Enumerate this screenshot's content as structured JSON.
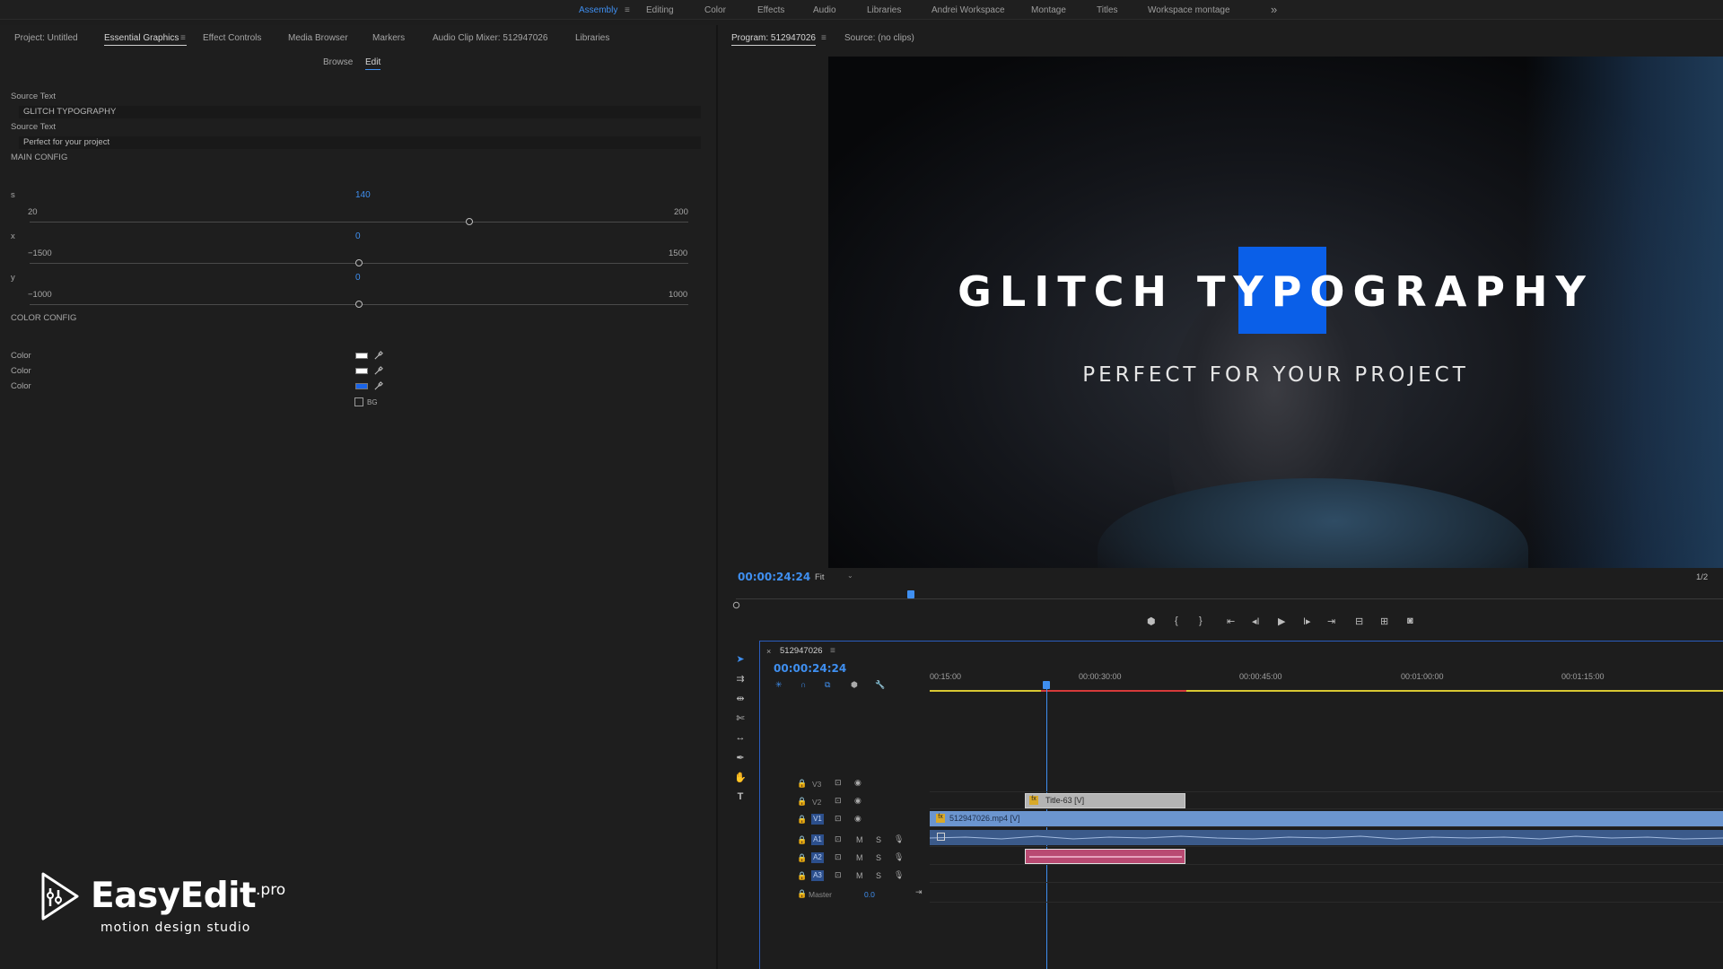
{
  "workspaces": [
    "Assembly",
    "Editing",
    "Color",
    "Effects",
    "Audio",
    "Libraries",
    "Andrei Workspace",
    "Montage",
    "Titles",
    "Workspace montage"
  ],
  "workspace_overflow": "»",
  "left_tabs": {
    "project": "Project: Untitled",
    "essential_graphics": "Essential Graphics",
    "effect_controls": "Effect Controls",
    "media_browser": "Media Browser",
    "markers": "Markers",
    "audio_clip_mixer": "Audio Clip Mixer: 512947026",
    "libraries": "Libraries"
  },
  "eg": {
    "browse": "Browse",
    "edit": "Edit",
    "source_text_label_1": "Source Text",
    "source_text_value_1": "GLITCH TYPOGRAPHY",
    "source_text_label_2": "Source Text",
    "source_text_value_2": "Perfect for your project",
    "main_config": "MAIN CONFIG",
    "s": {
      "label": "s",
      "value": "140",
      "min": "20",
      "max": "200",
      "fraction": 0.667
    },
    "x": {
      "label": "x",
      "value": "0",
      "min": "−1500",
      "max": "1500",
      "fraction": 0.5
    },
    "y": {
      "label": "y",
      "value": "0",
      "min": "−1000",
      "max": "1000",
      "fraction": 0.5
    },
    "color_config": "COLOR CONFIG",
    "colors": [
      {
        "label": "Color",
        "hex": "#ffffff"
      },
      {
        "label": "Color",
        "hex": "#ffffff"
      },
      {
        "label": "Color",
        "hex": "#1a64e8"
      }
    ],
    "bg_label": "BG",
    "bg_checked": false
  },
  "program": {
    "tab_program": "Program: 512947026",
    "tab_source": "Source: (no clips)",
    "title_main": "GLITCH TYPOGRAPHY",
    "title_sub": "PERFECT FOR YOUR PROJECT",
    "highlight_color": "#0a5fe8",
    "timecode": "00:00:24:24",
    "fit": "Fit",
    "resolution": "1/2"
  },
  "timeline": {
    "sequence_name": "512947026",
    "timecode": "00:00:24:24",
    "ruler": [
      "00:15:00",
      "00:00:30:00",
      "00:00:45:00",
      "00:01:00:00",
      "00:01:15:00"
    ],
    "video_tracks": [
      "V3",
      "V2",
      "V1"
    ],
    "audio_tracks": [
      "A1",
      "A2",
      "A3"
    ],
    "master_label": "Master",
    "master_value": "0.0",
    "clip_title": "Title-63 [V]",
    "clip_video": "512947026.mp4 [V]"
  },
  "logo": {
    "name": "EasyEdit",
    "suffix": ".pro",
    "tagline": "motion design studio"
  }
}
